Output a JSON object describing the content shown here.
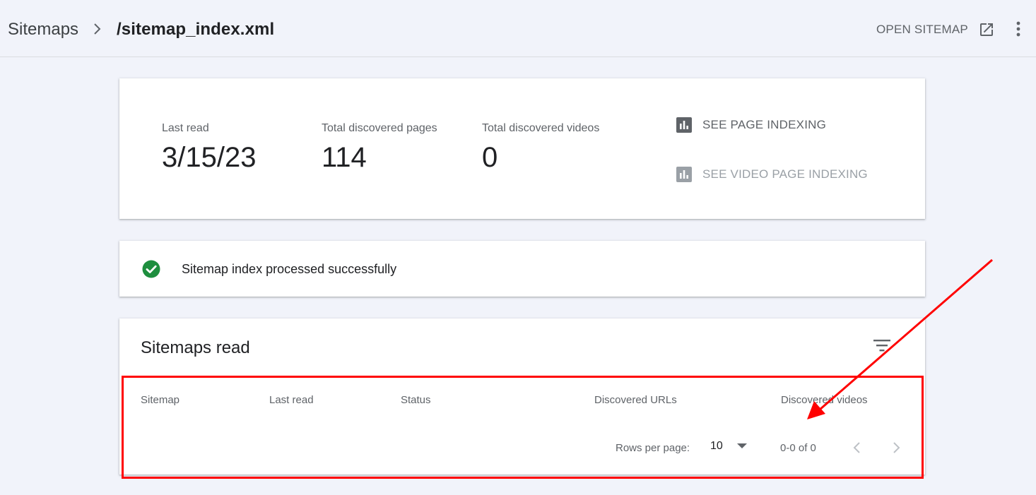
{
  "header": {
    "breadcrumb_root": "Sitemaps",
    "breadcrumb_current": "/sitemap_index.xml",
    "open_sitemap_label": "OPEN SITEMAP"
  },
  "stats": {
    "last_read_label": "Last read",
    "last_read_value": "3/15/23",
    "pages_label": "Total discovered pages",
    "pages_value": "114",
    "videos_label": "Total discovered videos",
    "videos_value": "0",
    "see_page_indexing": "SEE PAGE INDEXING",
    "see_video_indexing": "SEE VIDEO PAGE INDEXING"
  },
  "status": {
    "message": "Sitemap index processed successfully",
    "icon": "check-circle-icon",
    "color": "#1e8e3e"
  },
  "table": {
    "title": "Sitemaps read",
    "columns": [
      "Sitemap",
      "Last read",
      "Status",
      "Discovered URLs",
      "Discovered videos"
    ],
    "rows_per_page_label": "Rows per page:",
    "rows_per_page_value": "10",
    "range": "0-0 of 0"
  },
  "annotation": {
    "color": "#ff0000"
  }
}
